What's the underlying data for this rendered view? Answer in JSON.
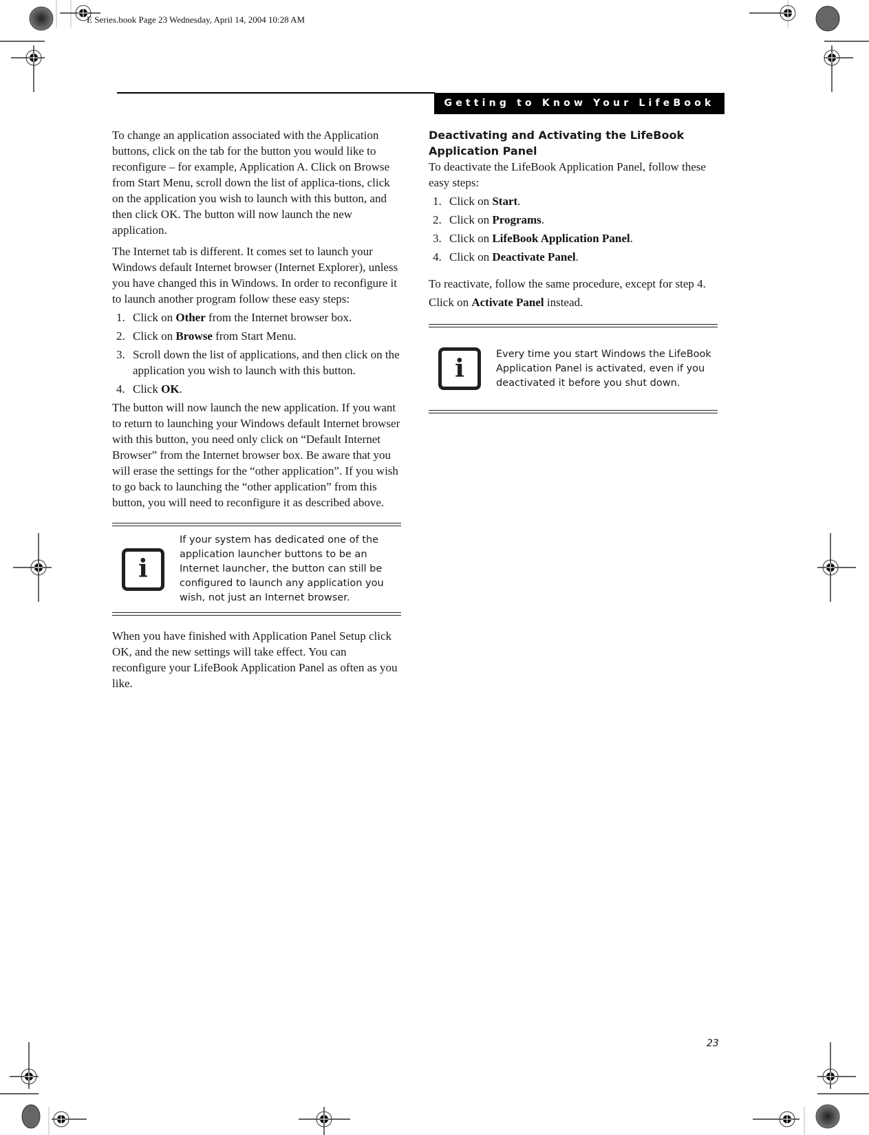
{
  "slug": "E Series.book  Page 23  Wednesday, April 14, 2004  10:28 AM",
  "header": {
    "section_title": "Getting to Know Your LifeBook"
  },
  "left_column": {
    "paragraph_1": "To change an application associated with the Application buttons, click on the tab for the button you would like to reconfigure – for example, Application A. Click on Browse from Start Menu, scroll down the list of applica-tions, click on the application you wish to launch with this button, and then click OK. The button will now launch the new application.",
    "paragraph_2": "The Internet tab is different. It comes set to launch your Windows default Internet browser (Internet Explorer), unless you have changed this in Windows. In order to reconfigure it to launch another program follow these easy steps:",
    "steps": [
      {
        "num": "1.",
        "pre": "Click on ",
        "bold": "Other",
        "post": " from the Internet browser box."
      },
      {
        "num": "2.",
        "pre": "Click on ",
        "bold": "Browse",
        "post": " from Start Menu."
      },
      {
        "num": "3.",
        "pre": "Scroll down the list of applications, and then click on the application you wish to launch with this button.",
        "bold": "",
        "post": ""
      },
      {
        "num": "4.",
        "pre": "Click ",
        "bold": "OK",
        "post": "."
      }
    ],
    "paragraph_3": "The button will now launch the new application. If you want to return to launching your Windows default Internet browser with this button, you need only click on “Default Internet Browser” from the Internet browser box. Be aware that you will erase the settings for the “other application”. If you wish to go back to launching the “other application” from this button, you will need to reconfigure it as described above.",
    "note": {
      "icon": "info-icon",
      "glyph": "i",
      "text": "If your system has dedicated one of the application launcher buttons to be an Internet launcher, the button can still be configured to launch any application you wish, not just an Internet browser."
    },
    "paragraph_4": "When you have finished with Application Panel Setup click OK, and the new settings will take effect. You can reconfigure your LifeBook Application Panel as often as you like."
  },
  "right_column": {
    "heading": "Deactivating and Activating the LifeBook Application Panel",
    "intro": "To deactivate the LifeBook Application Panel, follow these easy steps:",
    "steps": [
      {
        "num": "1.",
        "pre": "Click on ",
        "bold": "Start",
        "post": "."
      },
      {
        "num": "2.",
        "pre": "Click on ",
        "bold": "Programs",
        "post": "."
      },
      {
        "num": "3.",
        "pre": "Click on ",
        "bold": "LifeBook Application Panel",
        "post": "."
      },
      {
        "num": "4.",
        "pre": "Click on ",
        "bold": "Deactivate Panel",
        "post": "."
      }
    ],
    "reactivate": {
      "pre": "To reactivate, follow the same procedure, except for step 4. Click on ",
      "bold": "Activate Panel",
      "post": " instead."
    },
    "note": {
      "icon": "info-icon",
      "glyph": "i",
      "text": "Every time you start Windows the LifeBook Application Panel is activated, even if you deactivated it before you shut down."
    }
  },
  "footer": {
    "page_number": "23"
  }
}
